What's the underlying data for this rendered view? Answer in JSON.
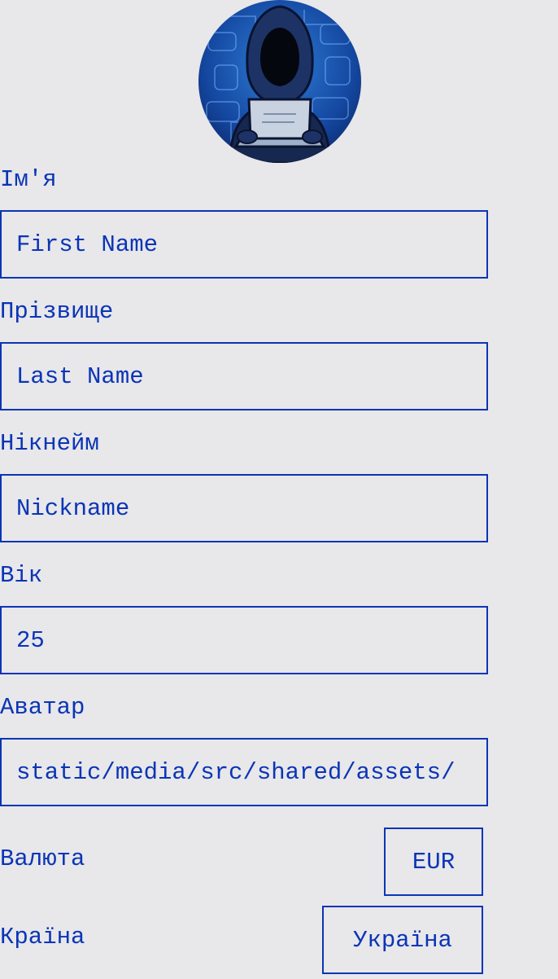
{
  "avatar": {
    "icon": "hacker-avatar-icon"
  },
  "form": {
    "first_name": {
      "label": "Ім'я",
      "placeholder": "First Name",
      "value": ""
    },
    "last_name": {
      "label": "Прізвище",
      "placeholder": "Last Name",
      "value": ""
    },
    "nickname": {
      "label": "Нікнейм",
      "placeholder": "Nickname",
      "value": ""
    },
    "age": {
      "label": "Вік",
      "value": "25"
    },
    "avatar_path": {
      "label": "Аватар",
      "value": "static/media/src/shared/assets/"
    },
    "currency": {
      "label": "Валюта",
      "selected": "EUR"
    },
    "country": {
      "label": "Країна",
      "selected": "Україна"
    }
  },
  "colors": {
    "accent": "#0a35b5",
    "background": "#e8e7ea"
  }
}
